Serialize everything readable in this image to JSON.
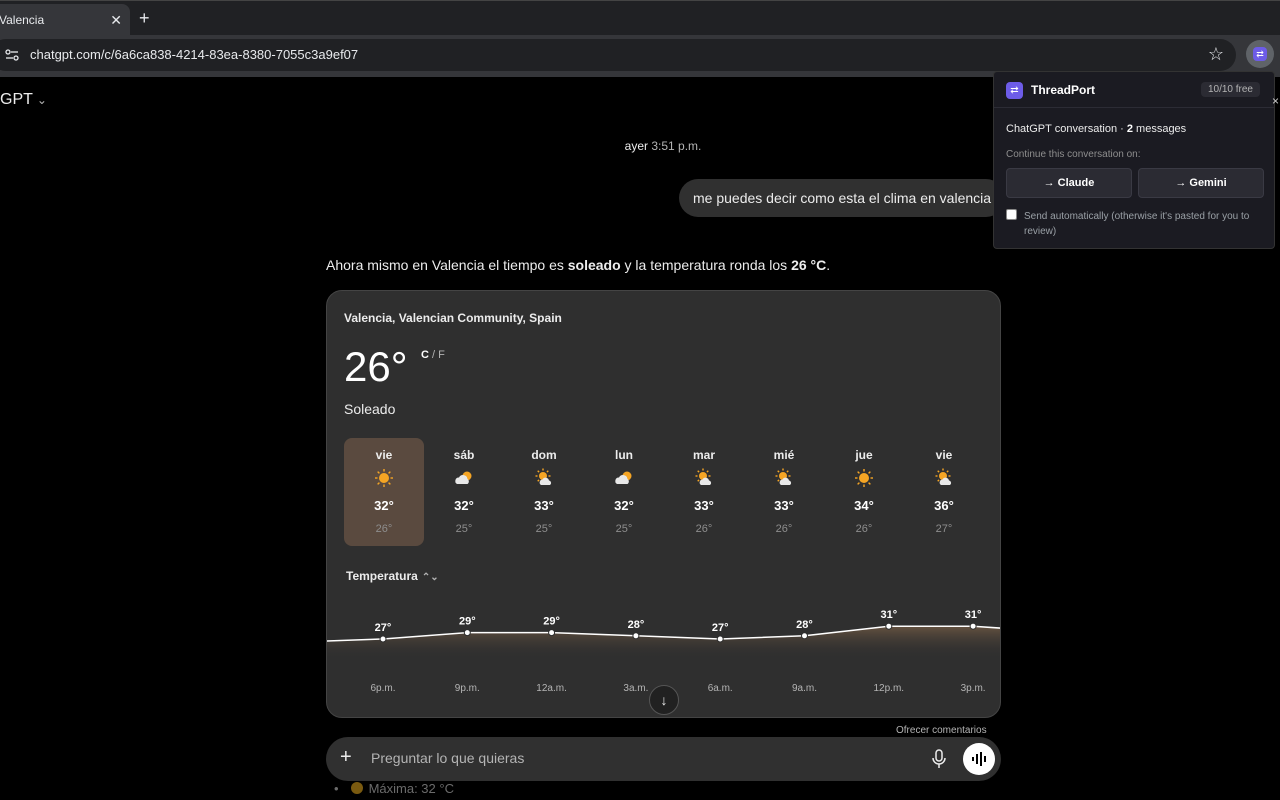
{
  "browser": {
    "tab_title": "Valencia",
    "url": "chatgpt.com/c/6a6ca838-4214-83ea-8380-7055c3a9ef07"
  },
  "chat": {
    "model_name": "GPT",
    "timestamp_day": "ayer",
    "timestamp_time": "3:51 p.m.",
    "user_message": "me puedes decir como esta el clima en valencia",
    "answer": {
      "part1": "Ahora mismo en Valencia el tiempo es ",
      "bold1": "soleado",
      "part2": " y la temperatura ronda los ",
      "bold2": "26 °C",
      "part3": "."
    },
    "feedback_label": "Ofrecer comentarios",
    "composer_placeholder": "Preguntar lo que quieras",
    "hidden_line": "Máxima: 32 °C"
  },
  "weather": {
    "location": "Valencia, Valencian Community, Spain",
    "current_temp": "26°",
    "unit_c": "C",
    "unit_sep": " / ",
    "unit_f": "F",
    "condition": "Soleado",
    "metric_selector": "Temperatura",
    "days": [
      {
        "name": "vie",
        "icon": "sun",
        "hi": "32°",
        "lo": "26°",
        "selected": true
      },
      {
        "name": "sáb",
        "icon": "partly-cloudy",
        "hi": "32°",
        "lo": "25°"
      },
      {
        "name": "dom",
        "icon": "sun-cloud",
        "hi": "33°",
        "lo": "25°"
      },
      {
        "name": "lun",
        "icon": "partly-cloudy",
        "hi": "32°",
        "lo": "25°"
      },
      {
        "name": "mar",
        "icon": "sun-cloud",
        "hi": "33°",
        "lo": "26°"
      },
      {
        "name": "mié",
        "icon": "sun-cloud",
        "hi": "33°",
        "lo": "26°"
      },
      {
        "name": "jue",
        "icon": "sun",
        "hi": "34°",
        "lo": "26°"
      },
      {
        "name": "vie",
        "icon": "sun-cloud",
        "hi": "36°",
        "lo": "27°"
      }
    ]
  },
  "chart_data": {
    "type": "area",
    "categories": [
      "6p.m.",
      "9p.m.",
      "12a.m.",
      "3a.m.",
      "6a.m.",
      "9a.m.",
      "12p.m.",
      "3p.m."
    ],
    "values": [
      27,
      29,
      29,
      28,
      27,
      28,
      31,
      31
    ],
    "labels": [
      "27°",
      "29°",
      "29°",
      "28°",
      "27°",
      "28°",
      "31°",
      "31°"
    ],
    "title": "",
    "xlabel": "",
    "ylabel": "",
    "ylim": [
      20,
      36
    ]
  },
  "extension": {
    "title": "ThreadPort",
    "badge": "10/10 free",
    "conv_prefix": "ChatGPT conversation · ",
    "conv_count": "2",
    "conv_suffix": " messages",
    "continue_label": "Continue this conversation on:",
    "claude_button": "→ Claude",
    "gemini_button": "→ Gemini",
    "auto_send_label": "Send automatically (otherwise it's pasted for you to review)"
  },
  "colors": {
    "background": "#000000",
    "card": "#2f2f2f",
    "selected_day": "#5a4a3f",
    "sun": "#f5a524",
    "extension_accent": "#6d5ce8"
  }
}
